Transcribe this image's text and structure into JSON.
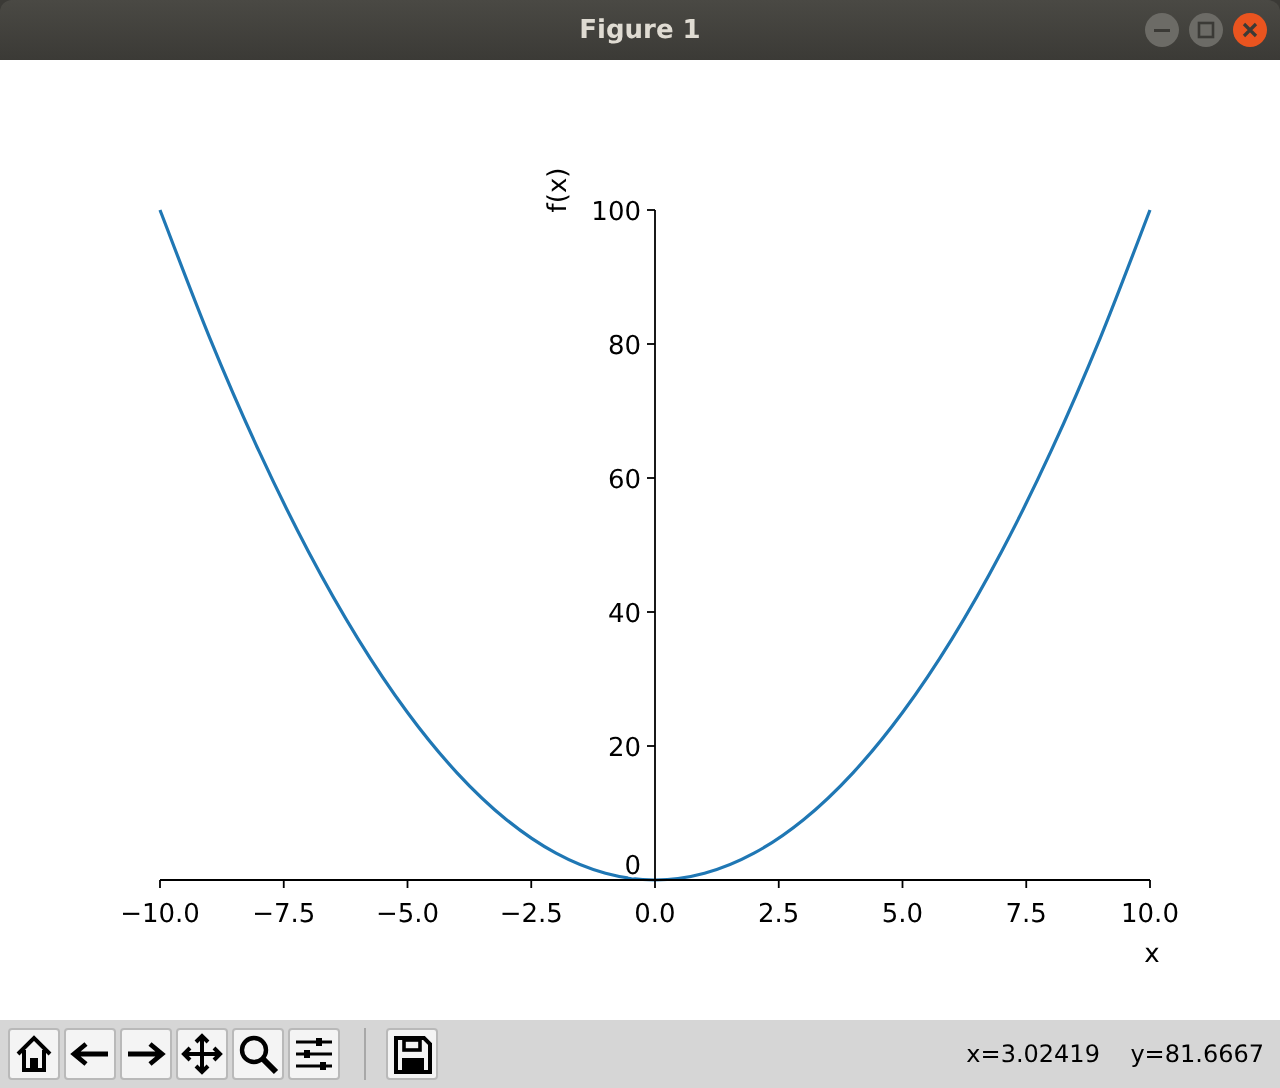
{
  "window": {
    "title": "Figure 1"
  },
  "figure": {
    "chart_data": {
      "type": "line",
      "xlabel": "x",
      "ylabel": "f(x)",
      "x": [
        -10,
        -9,
        -8,
        -7,
        -6,
        -5,
        -4,
        -3,
        -2,
        -1,
        0,
        1,
        2,
        3,
        4,
        5,
        6,
        7,
        8,
        9,
        10
      ],
      "series": [
        {
          "color": "#1f77b4",
          "values": [
            100,
            81,
            64,
            49,
            36,
            25,
            16,
            9,
            4,
            1,
            0,
            1,
            4,
            9,
            16,
            25,
            36,
            49,
            64,
            81,
            100
          ]
        }
      ],
      "xlim": [
        -10,
        10
      ],
      "ylim": [
        0,
        100
      ],
      "xticks": [
        {
          "value": -10,
          "label": "−10.0"
        },
        {
          "value": -7.5,
          "label": "−7.5"
        },
        {
          "value": -5,
          "label": "−5.0"
        },
        {
          "value": -2.5,
          "label": "−2.5"
        },
        {
          "value": 0,
          "label": "0.0"
        },
        {
          "value": 2.5,
          "label": "2.5"
        },
        {
          "value": 5,
          "label": "5.0"
        },
        {
          "value": 7.5,
          "label": "7.5"
        },
        {
          "value": 10,
          "label": "10.0"
        }
      ],
      "yticks": [
        0,
        20,
        40,
        60,
        80,
        100
      ]
    }
  },
  "toolbar": {
    "buttons": [
      {
        "kind": "home"
      },
      {
        "kind": "back"
      },
      {
        "kind": "forward"
      },
      {
        "kind": "pan"
      },
      {
        "kind": "zoom"
      },
      {
        "kind": "configure"
      },
      {
        "kind": "separator"
      },
      {
        "kind": "save"
      }
    ],
    "status": "x=3.02419    y=81.6667"
  }
}
